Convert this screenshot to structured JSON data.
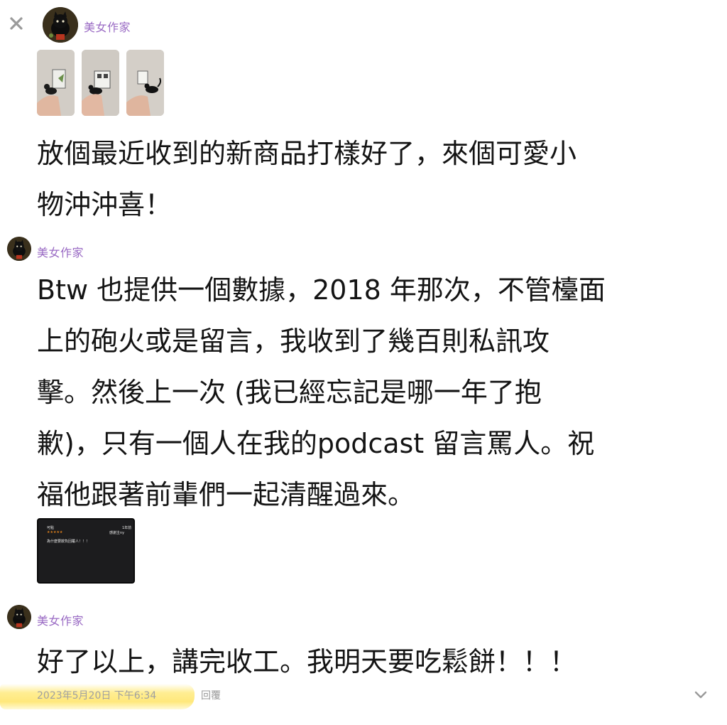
{
  "author": "美女作家",
  "post1": {
    "lines": [
      "放個最近收到的新商品打樣好了，來個可愛小",
      "物沖沖喜！"
    ]
  },
  "post2": {
    "lines": [
      "Btw 也提供一個數據，2018 年那次，不管檯面",
      "上的砲火或是留言，我收到了幾百則私訊攻",
      "擊。然後上一次 (我已經忘記是哪一年了抱",
      "歉)，只有一個人在我的podcast 留言罵人。祝",
      "福他跟著前輩們一起清醒過來。"
    ],
    "attachment": {
      "name": "可點",
      "time": "1年前",
      "thanks": "感謝主ny",
      "stars": "★★★★★",
      "text": "為什麼要欺負回覆人！！！"
    }
  },
  "post3": {
    "lines": [
      "好了以上，講完收工。我明天要吃鬆餅！！！"
    ]
  },
  "footer": {
    "timestamp": "2023年5月20日 下午6:34",
    "reply_label": "回覆"
  },
  "icons": {
    "close": "close-icon",
    "chevron": "chevron-down-icon"
  },
  "colors": {
    "author": "#9a6bc4",
    "highlight": "#ffe46e",
    "text": "#141414",
    "meta": "#a0a0a0"
  }
}
